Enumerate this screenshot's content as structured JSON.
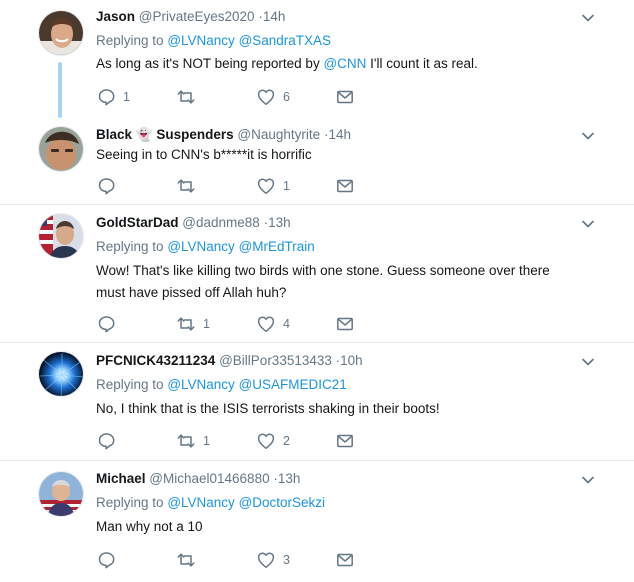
{
  "tweets": [
    {
      "name": "Jason",
      "handle": "@PrivateEyes2020",
      "time": "14h",
      "replying_label": "Replying to",
      "mention1": "@LVNancy",
      "mention2": "@SandraTXAS",
      "text_before": "As long as it's NOT being reported by ",
      "text_mention": "@CNN",
      "text_after": " I'll count it as real.",
      "reply_count": "1",
      "retweet_count": "",
      "like_count": "6",
      "avatar": "smiling-man-photo"
    },
    {
      "name_part1": "Black",
      "name_emoji": "👻",
      "name_part2": "Suspenders",
      "handle": "@Naughtyrite",
      "time": "14h",
      "text": "Seeing in to CNN's b*****it is horrific",
      "reply_count": "",
      "retweet_count": "",
      "like_count": "1",
      "avatar": "young-man-photo"
    },
    {
      "name": "GoldStarDad",
      "handle": "@dadnme88",
      "time": "13h",
      "replying_label": "Replying to",
      "mention1": "@LVNancy",
      "mention2": "@MrEdTrain",
      "text": "Wow!  That's like killing two birds with one stone.  Guess someone over there must have pissed off Allah huh?",
      "reply_count": "",
      "retweet_count": "1",
      "like_count": "4",
      "avatar": "man-with-flag-photo"
    },
    {
      "name": "PFCNICK43211234",
      "handle": "@BillPor33513433",
      "time": "10h",
      "replying_label": "Replying to",
      "mention1": "@LVNancy",
      "mention2": "@USAFMEDIC21",
      "text": "No, I think that is the ISIS terrorists shaking in their boots!",
      "reply_count": "",
      "retweet_count": "1",
      "like_count": "2",
      "avatar": "blue-burst-image"
    },
    {
      "name": "Michael",
      "handle": "@Michael01466880",
      "time": "13h",
      "replying_label": "Replying to",
      "mention1": "@LVNancy",
      "mention2": "@DoctorSekzi",
      "text": "Man why not a 10",
      "reply_count": "",
      "retweet_count": "",
      "like_count": "3",
      "avatar": "man-at-flag-photo"
    }
  ],
  "separator_dot": "·",
  "colors": {
    "link": "#1b95e0",
    "secondary_text": "#657786",
    "primary_text": "#14171a",
    "thread_line": "#a9d4f5",
    "divider": "#e6ecf0"
  }
}
